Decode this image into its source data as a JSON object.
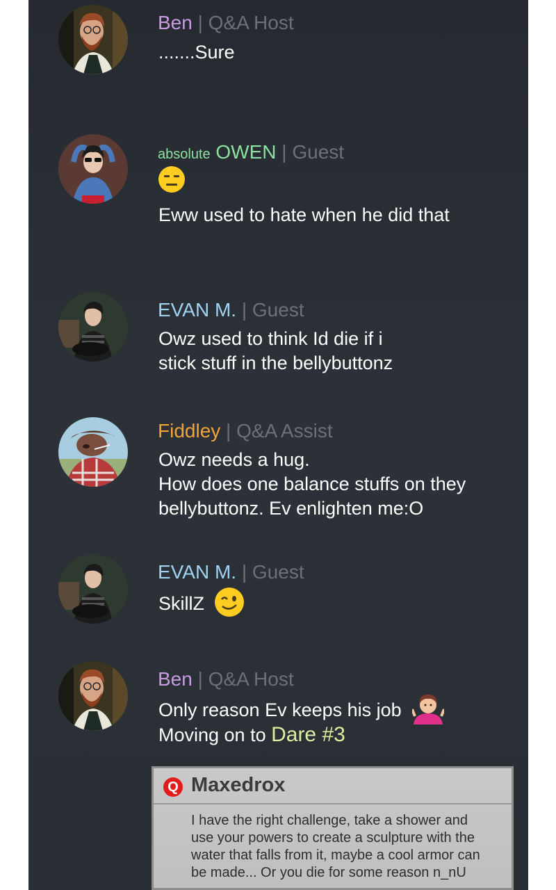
{
  "messages": [
    {
      "name": "Ben",
      "role": "Q&A Host",
      "lines": [
        ".......Sure"
      ]
    },
    {
      "prefix": "absolute",
      "name": "OWEN",
      "role": "Guest",
      "emoji": "expressionless-face",
      "lines": [
        "Eww used to hate when he did that"
      ]
    },
    {
      "name": "EVAN M.",
      "role": "Guest",
      "lines": [
        "Owz used to think Id die if i",
        "stick stuff in the bellybuttonz"
      ]
    },
    {
      "name": "Fiddley",
      "role": "Q&A Assist",
      "lines": [
        "Owz needs a hug.",
        "How does one balance stuffs on they",
        "bellybuttonz. Ev enlighten me:O"
      ]
    },
    {
      "name": "EVAN M.",
      "role": "Guest",
      "lines": [
        "SkillZ"
      ],
      "emoji": "winking-face"
    },
    {
      "name": "Ben",
      "role": "Q&A Host",
      "lines": [
        "Only reason Ev keeps his job",
        "Moving on to "
      ],
      "highlight": "Dare #3",
      "emoji": "shrugging-person"
    }
  ],
  "separator": "|",
  "quote": {
    "icon": "Q",
    "author": "Maxedrox",
    "lines": [
      "I have the right challenge, take a shower and",
      "use your powers to create a sculpture with the",
      "water that falls from it, maybe a cool armor can",
      "be made... Or you die for some reason n_nU"
    ]
  },
  "colors": {
    "ben": "#c79be0",
    "owen": "#8de0a0",
    "evan": "#9fd3f0",
    "fiddley": "#f0a53a",
    "dare": "#d8f0a0",
    "role": "#6b7178",
    "panel": "#2a2e35"
  }
}
